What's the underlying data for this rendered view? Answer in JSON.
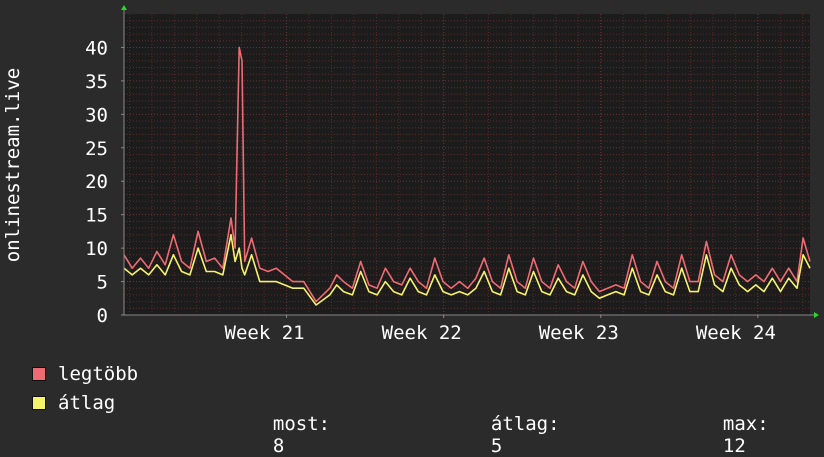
{
  "colors": {
    "background": "#2b2b2b",
    "plot_background": "#1c1c1c",
    "grid_minor": "#5a2a2a",
    "grid_major": "#6b3434",
    "axis": "#888888",
    "arrow": "#22dd22",
    "max_series": "#ef6b73",
    "avg_series": "#f5f36b"
  },
  "legend": {
    "max_label": "legtöbb",
    "avg_label": "átlag"
  },
  "stats": {
    "now_label": "most:",
    "now_value": "8",
    "avg_label": "átlag:",
    "avg_value": "5",
    "max_label": "max:",
    "max_value": "12"
  },
  "chart_data": {
    "type": "line",
    "ylabel": "onlinestream.live",
    "ylim": [
      0,
      45
    ],
    "yticks": [
      0,
      5,
      10,
      15,
      20,
      25,
      30,
      35,
      40
    ],
    "xlim": [
      0,
      1
    ],
    "xticks": [
      {
        "label": "Week 21",
        "x": 0.237
      },
      {
        "label": "Week 22",
        "x": 0.466
      },
      {
        "label": "Week 23",
        "x": 0.695
      },
      {
        "label": "Week 24",
        "x": 0.924
      }
    ],
    "grid": true,
    "series": [
      {
        "name": "legtöbb",
        "color": "#ef6b73",
        "points": [
          [
            0.0,
            9
          ],
          [
            0.012,
            7
          ],
          [
            0.024,
            8.5
          ],
          [
            0.036,
            7
          ],
          [
            0.048,
            9.5
          ],
          [
            0.06,
            7.5
          ],
          [
            0.072,
            12
          ],
          [
            0.084,
            8
          ],
          [
            0.096,
            7
          ],
          [
            0.108,
            12.5
          ],
          [
            0.12,
            8
          ],
          [
            0.132,
            8.5
          ],
          [
            0.144,
            7
          ],
          [
            0.156,
            14.5
          ],
          [
            0.162,
            10
          ],
          [
            0.168,
            40
          ],
          [
            0.172,
            38
          ],
          [
            0.176,
            8
          ],
          [
            0.186,
            11.5
          ],
          [
            0.198,
            7
          ],
          [
            0.21,
            6.5
          ],
          [
            0.222,
            7
          ],
          [
            0.234,
            6
          ],
          [
            0.246,
            5
          ],
          [
            0.262,
            5
          ],
          [
            0.28,
            2
          ],
          [
            0.3,
            4
          ],
          [
            0.31,
            6
          ],
          [
            0.32,
            5
          ],
          [
            0.333,
            4
          ],
          [
            0.345,
            8
          ],
          [
            0.357,
            4.5
          ],
          [
            0.369,
            4
          ],
          [
            0.381,
            7
          ],
          [
            0.393,
            5
          ],
          [
            0.405,
            4.5
          ],
          [
            0.417,
            7
          ],
          [
            0.429,
            5
          ],
          [
            0.441,
            4
          ],
          [
            0.453,
            8.5
          ],
          [
            0.465,
            5
          ],
          [
            0.477,
            4
          ],
          [
            0.489,
            5
          ],
          [
            0.501,
            4
          ],
          [
            0.513,
            5.5
          ],
          [
            0.525,
            8.5
          ],
          [
            0.537,
            5
          ],
          [
            0.549,
            4
          ],
          [
            0.561,
            9
          ],
          [
            0.573,
            5
          ],
          [
            0.585,
            4
          ],
          [
            0.597,
            8.5
          ],
          [
            0.609,
            5
          ],
          [
            0.621,
            4
          ],
          [
            0.633,
            7.5
          ],
          [
            0.645,
            5
          ],
          [
            0.657,
            4
          ],
          [
            0.669,
            8
          ],
          [
            0.681,
            5
          ],
          [
            0.693,
            3.5
          ],
          [
            0.705,
            4
          ],
          [
            0.717,
            4.5
          ],
          [
            0.729,
            4
          ],
          [
            0.741,
            9
          ],
          [
            0.753,
            5
          ],
          [
            0.765,
            4
          ],
          [
            0.777,
            8
          ],
          [
            0.789,
            5
          ],
          [
            0.801,
            4
          ],
          [
            0.813,
            9
          ],
          [
            0.825,
            5
          ],
          [
            0.837,
            5
          ],
          [
            0.849,
            11
          ],
          [
            0.861,
            6
          ],
          [
            0.873,
            5
          ],
          [
            0.885,
            9
          ],
          [
            0.897,
            6
          ],
          [
            0.909,
            5
          ],
          [
            0.921,
            6
          ],
          [
            0.933,
            5
          ],
          [
            0.945,
            7
          ],
          [
            0.957,
            5
          ],
          [
            0.969,
            7
          ],
          [
            0.981,
            5
          ],
          [
            0.99,
            11.5
          ],
          [
            1.0,
            8
          ]
        ]
      },
      {
        "name": "átlag",
        "color": "#f5f36b",
        "points": [
          [
            0.0,
            7
          ],
          [
            0.012,
            6
          ],
          [
            0.024,
            7
          ],
          [
            0.036,
            6
          ],
          [
            0.048,
            7.5
          ],
          [
            0.06,
            6
          ],
          [
            0.072,
            9
          ],
          [
            0.084,
            6.5
          ],
          [
            0.096,
            6
          ],
          [
            0.108,
            10
          ],
          [
            0.12,
            6.5
          ],
          [
            0.132,
            6.5
          ],
          [
            0.144,
            6
          ],
          [
            0.156,
            12
          ],
          [
            0.162,
            8
          ],
          [
            0.168,
            10
          ],
          [
            0.172,
            7
          ],
          [
            0.176,
            6
          ],
          [
            0.186,
            9
          ],
          [
            0.198,
            5
          ],
          [
            0.21,
            5
          ],
          [
            0.222,
            5
          ],
          [
            0.234,
            4.5
          ],
          [
            0.246,
            4
          ],
          [
            0.262,
            4
          ],
          [
            0.28,
            1.5
          ],
          [
            0.3,
            3
          ],
          [
            0.31,
            4.5
          ],
          [
            0.32,
            3.5
          ],
          [
            0.333,
            3
          ],
          [
            0.345,
            6.5
          ],
          [
            0.357,
            3.5
          ],
          [
            0.369,
            3
          ],
          [
            0.381,
            5
          ],
          [
            0.393,
            3.5
          ],
          [
            0.405,
            3
          ],
          [
            0.417,
            5.5
          ],
          [
            0.429,
            3.5
          ],
          [
            0.441,
            3
          ],
          [
            0.453,
            6
          ],
          [
            0.465,
            3.5
          ],
          [
            0.477,
            3
          ],
          [
            0.489,
            3.5
          ],
          [
            0.501,
            3
          ],
          [
            0.513,
            4
          ],
          [
            0.525,
            6.5
          ],
          [
            0.537,
            3.5
          ],
          [
            0.549,
            3
          ],
          [
            0.561,
            7
          ],
          [
            0.573,
            3.5
          ],
          [
            0.585,
            3
          ],
          [
            0.597,
            6.5
          ],
          [
            0.609,
            3.5
          ],
          [
            0.621,
            3
          ],
          [
            0.633,
            5.5
          ],
          [
            0.645,
            3.5
          ],
          [
            0.657,
            3
          ],
          [
            0.669,
            6
          ],
          [
            0.681,
            3.5
          ],
          [
            0.693,
            2.5
          ],
          [
            0.705,
            3
          ],
          [
            0.717,
            3.5
          ],
          [
            0.729,
            3
          ],
          [
            0.741,
            7
          ],
          [
            0.753,
            3.5
          ],
          [
            0.765,
            3
          ],
          [
            0.777,
            6
          ],
          [
            0.789,
            3.5
          ],
          [
            0.801,
            3
          ],
          [
            0.813,
            7
          ],
          [
            0.825,
            3.5
          ],
          [
            0.837,
            3.5
          ],
          [
            0.849,
            9
          ],
          [
            0.861,
            4.5
          ],
          [
            0.873,
            3.5
          ],
          [
            0.885,
            7
          ],
          [
            0.897,
            4.5
          ],
          [
            0.909,
            3.5
          ],
          [
            0.921,
            4.5
          ],
          [
            0.933,
            3.5
          ],
          [
            0.945,
            5.5
          ],
          [
            0.957,
            3.5
          ],
          [
            0.969,
            5.5
          ],
          [
            0.981,
            4
          ],
          [
            0.99,
            9
          ],
          [
            1.0,
            7
          ]
        ]
      }
    ]
  }
}
